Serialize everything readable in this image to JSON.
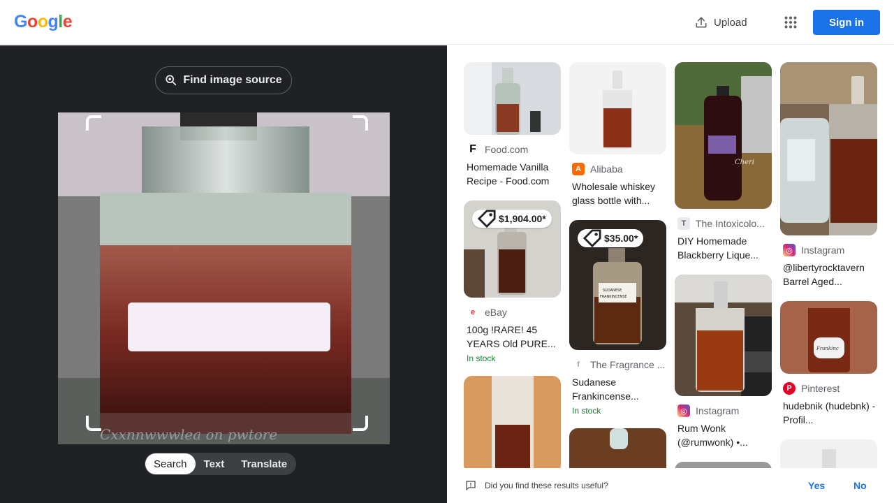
{
  "header": {
    "logo_letters": [
      "G",
      "o",
      "o",
      "g",
      "l",
      "e"
    ],
    "logo_colors": [
      "#4285f4",
      "#ea4335",
      "#fbbc05",
      "#4285f4",
      "#34a853",
      "#ea4335"
    ],
    "upload_label": "Upload",
    "signin_label": "Sign in"
  },
  "left": {
    "find_source_label": "Find image source",
    "watermark": "Cxxnnwwwlea on pwtore",
    "modes": [
      "Search",
      "Text",
      "Translate"
    ],
    "active_mode": "Search"
  },
  "results": [
    {
      "source": "Food.com",
      "favicon": "F",
      "favicon_color": "#000000",
      "title": "Homemade Vanilla Recipe - Food.com",
      "price": "",
      "stock": ""
    },
    {
      "source": "eBay",
      "favicon": "e",
      "favicon_color": "#e53238",
      "title": "100g !RARE! 45 YEARS Old PURE...",
      "price": "$1,904.00*",
      "stock": "In stock"
    },
    {
      "source": "Alibaba",
      "favicon": "A",
      "favicon_color": "#ff6a00",
      "title": "Wholesale whiskey glass bottle with...",
      "price": "",
      "stock": ""
    },
    {
      "source": "The Fragrance ...",
      "favicon": "f",
      "favicon_color": "#9aa0a6",
      "title": "Sudanese Frankincense...",
      "price": "$35.00*",
      "stock": "In stock"
    },
    {
      "source": "The Intoxicolo...",
      "favicon": "T",
      "favicon_color": "#5f6368",
      "title": "DIY Homemade Blackberry Lique...",
      "price": "",
      "stock": ""
    },
    {
      "source": "Instagram",
      "favicon": "◎",
      "favicon_color": "#d62976",
      "title": "Rum Wonk (@rumwonk) •...",
      "price": "",
      "stock": ""
    },
    {
      "source": "Instagram",
      "favicon": "◎",
      "favicon_color": "#d62976",
      "title": "@libertyrocktavern Barrel Aged...",
      "price": "",
      "stock": ""
    },
    {
      "source": "Pinterest",
      "favicon": "P",
      "favicon_color": "#e60023",
      "title": "hudebnik (hudebnk) - Profil...",
      "price": "",
      "stock": ""
    }
  ],
  "feedback": {
    "question": "Did you find these results useful?",
    "yes": "Yes",
    "no": "No"
  }
}
